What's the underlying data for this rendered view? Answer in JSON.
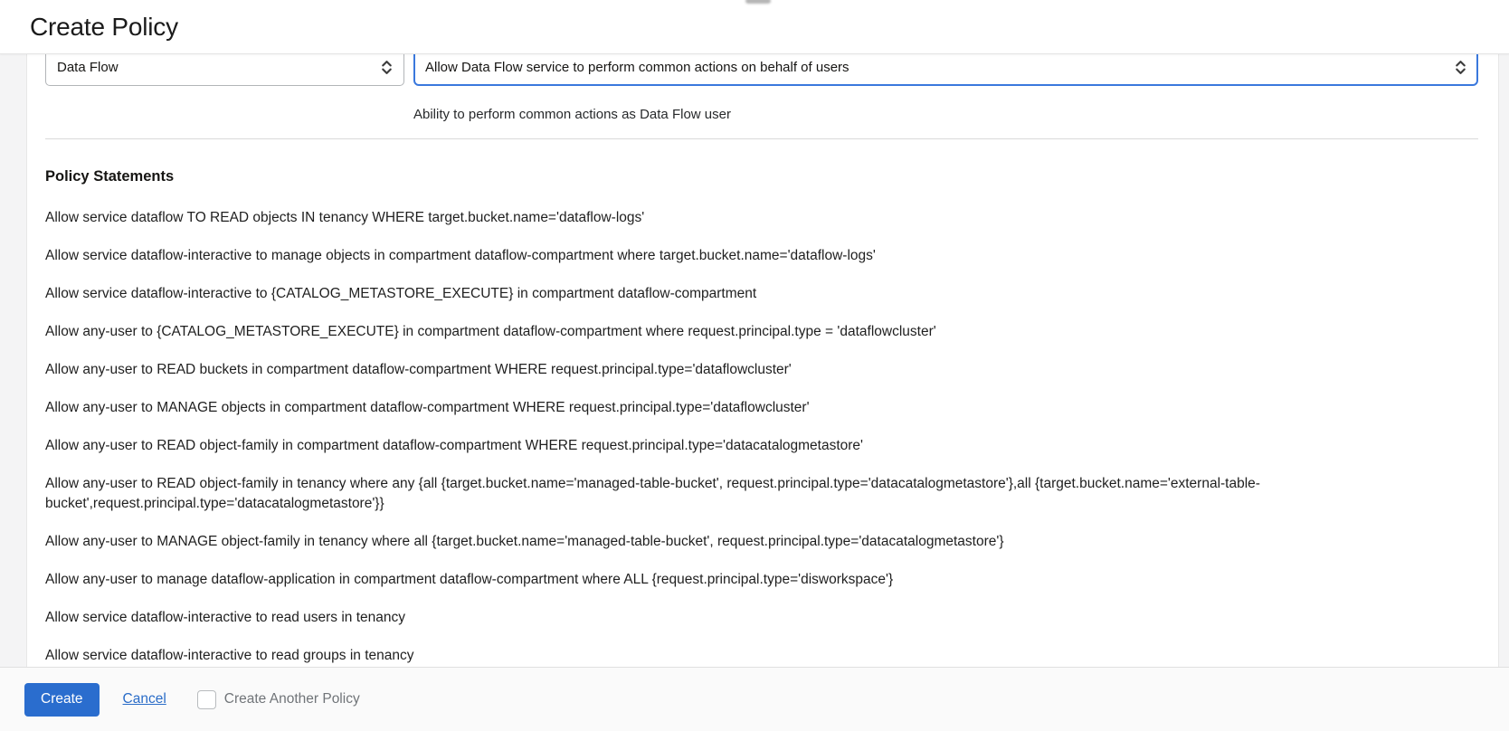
{
  "header": {
    "title": "Create Policy"
  },
  "form": {
    "service_select": {
      "value": "Data Flow"
    },
    "policy_template_select": {
      "value": "Allow Data Flow service to perform common actions on behalf of users"
    },
    "helper_text": "Ability to perform common actions as Data Flow user"
  },
  "statements": {
    "heading": "Policy Statements",
    "items": [
      "Allow service dataflow TO READ objects IN tenancy WHERE target.bucket.name='dataflow-logs'",
      "Allow service dataflow-interactive to manage objects in compartment dataflow-compartment where target.bucket.name='dataflow-logs'",
      "Allow service dataflow-interactive to {CATALOG_METASTORE_EXECUTE} in compartment dataflow-compartment",
      "Allow any-user to {CATALOG_METASTORE_EXECUTE} in compartment dataflow-compartment where request.principal.type = 'dataflowcluster'",
      "Allow any-user to READ buckets in compartment dataflow-compartment WHERE request.principal.type='dataflowcluster'",
      "Allow any-user to MANAGE objects in compartment dataflow-compartment WHERE request.principal.type='dataflowcluster'",
      "Allow any-user to READ object-family in compartment dataflow-compartment WHERE request.principal.type='datacatalogmetastore'",
      "Allow any-user to READ object-family in tenancy where any {all {target.bucket.name='managed-table-bucket', request.principal.type='datacatalogmetastore'},all {target.bucket.name='external-table-bucket',request.principal.type='datacatalogmetastore'}}",
      "Allow any-user to MANAGE object-family in tenancy where all {target.bucket.name='managed-table-bucket', request.principal.type='datacatalogmetastore'}",
      "Allow any-user to manage dataflow-application in compartment dataflow-compartment where ALL {request.principal.type='disworkspace'}",
      "Allow service dataflow-interactive to read users in tenancy",
      "Allow service dataflow-interactive to read groups in tenancy"
    ]
  },
  "footer": {
    "create_button": "Create",
    "cancel_link": "Cancel",
    "create_another_label": "Create Another Policy",
    "create_another_checked": false
  },
  "colors": {
    "accent_blue": "#2a6dce",
    "focus_border_blue": "#3a78dd",
    "link_blue": "#2a6cc8"
  }
}
